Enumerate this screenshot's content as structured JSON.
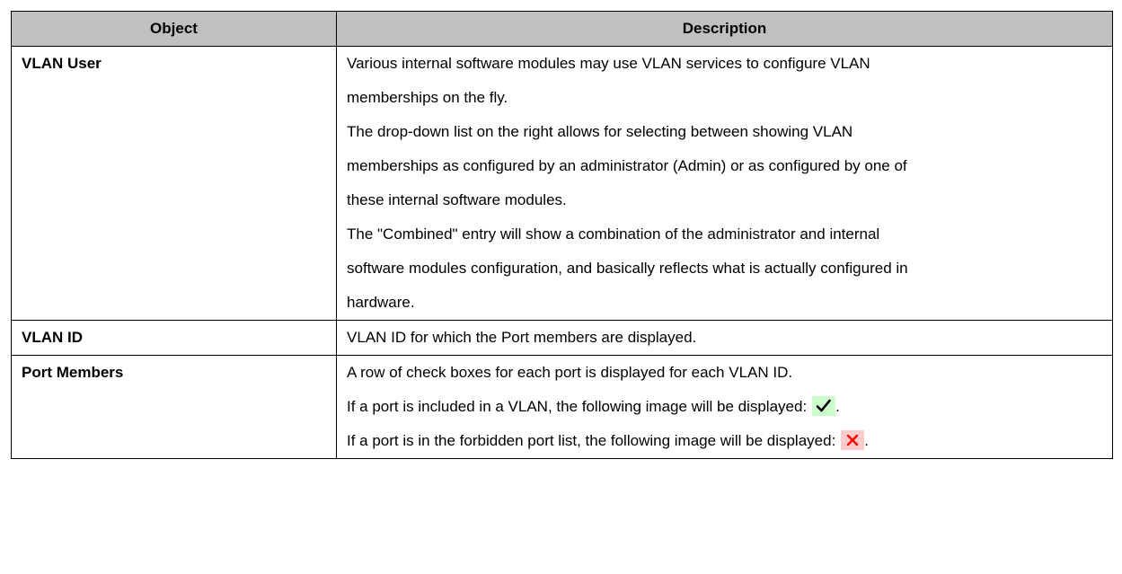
{
  "table": {
    "headers": {
      "object": "Object",
      "description": "Description"
    },
    "rows": [
      {
        "object": "VLAN User",
        "lines": [
          "Various internal software modules may use VLAN services to configure VLAN",
          "memberships on the fly.",
          "The drop-down list on the right allows for selecting between showing VLAN",
          "memberships as configured by an administrator (Admin) or as configured by one of",
          "these internal software modules.",
          "The \"Combined\" entry will show a combination of the administrator and internal",
          "software modules configuration, and basically reflects what is actually configured in",
          "hardware."
        ]
      },
      {
        "object": "VLAN ID",
        "lines": [
          "VLAN ID for which the Port members are displayed."
        ]
      },
      {
        "object": "Port Members",
        "lines": [
          "A row of check boxes for each port is displayed for each VLAN ID.",
          "If a port is included in a VLAN, the following image will be displayed:",
          "If a port is in the forbidden port list, the following image will be displayed:"
        ],
        "line_end": ".",
        "icons": {
          "included": "check-mark-icon",
          "forbidden": "cross-mark-icon"
        }
      }
    ]
  },
  "colors": {
    "header_bg": "#c0c0c0",
    "check_bg": "#ccffcc",
    "check_mark": "#000000",
    "cross_bg": "#ffcccc",
    "cross_mark": "#ff0000"
  }
}
